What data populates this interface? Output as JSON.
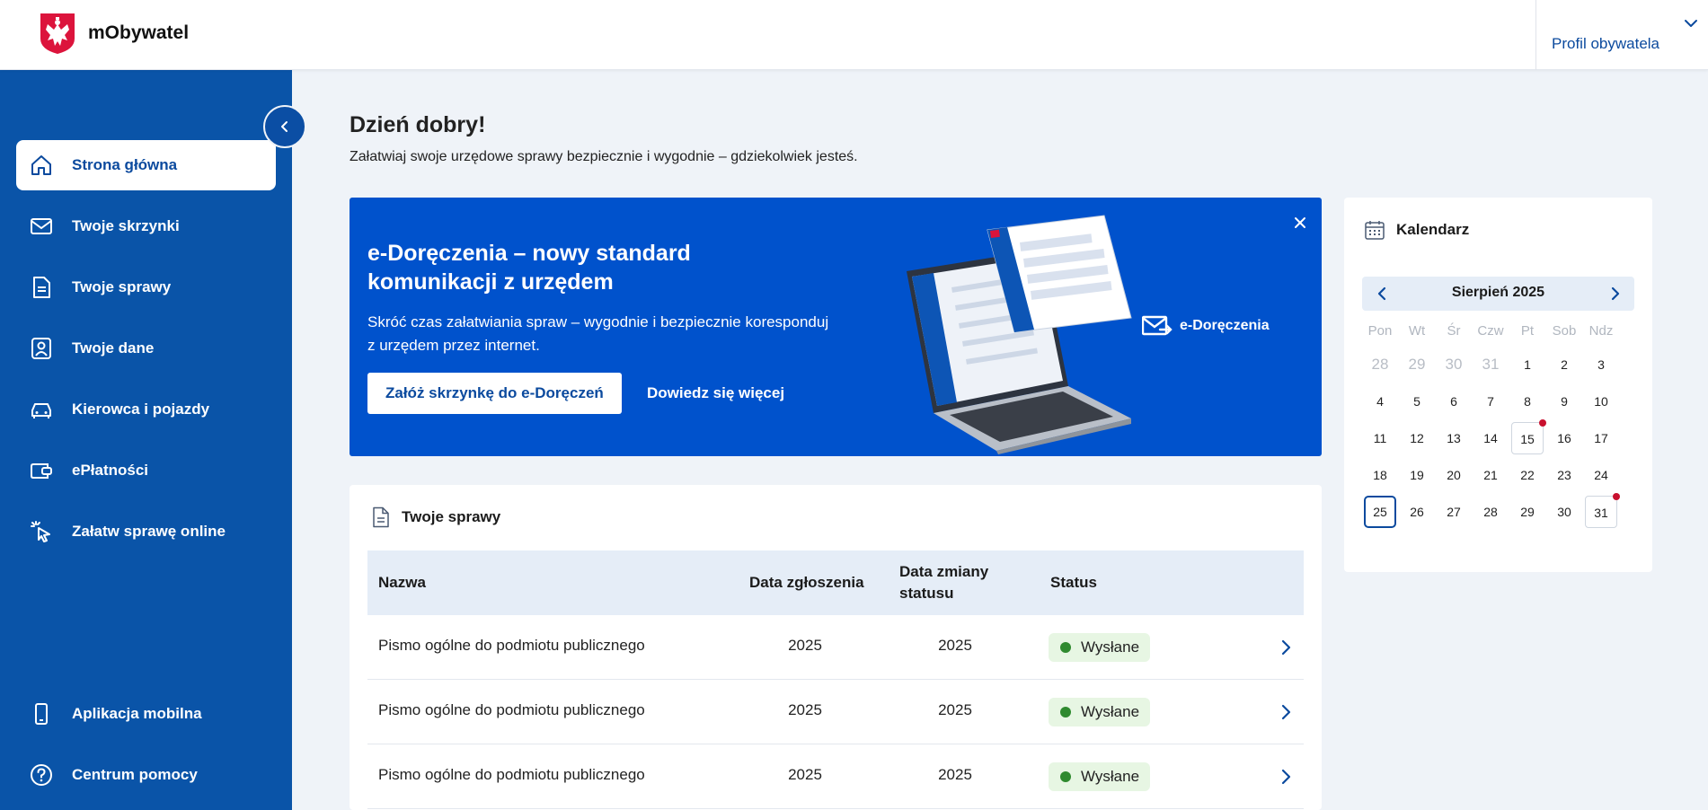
{
  "header": {
    "app_name": "mObywatel",
    "profile_label": "Profil obywatela"
  },
  "sidebar": {
    "items": [
      {
        "label": "Strona główna",
        "icon": "home-icon",
        "active": true
      },
      {
        "label": "Twoje skrzynki",
        "icon": "mail-icon"
      },
      {
        "label": "Twoje sprawy",
        "icon": "document-icon"
      },
      {
        "label": "Twoje dane",
        "icon": "id-card-icon"
      },
      {
        "label": "Kierowca i pojazdy",
        "icon": "car-icon"
      },
      {
        "label": "ePłatności",
        "icon": "wallet-icon"
      },
      {
        "label": "Załatw sprawę online",
        "icon": "cursor-click-icon"
      }
    ],
    "bottom_items": [
      {
        "label": "Aplikacja mobilna",
        "icon": "phone-icon"
      },
      {
        "label": "Centrum pomocy",
        "icon": "help-icon"
      }
    ]
  },
  "main": {
    "greeting": "Dzień dobry!",
    "subtitle": "Załatwiaj swoje urzędowe sprawy bezpiecznie i wygodnie – gdziekolwiek jesteś."
  },
  "banner": {
    "title": "e-Doręczenia – nowy standard komunikacji z urzędem",
    "text": "Skróć czas załatwiania spraw – wygodnie i bezpiecznie koresponduj z urzędem przez internet.",
    "primary_button": "Załóż skrzynkę do e-Doręczeń",
    "link": "Dowiedz się więcej",
    "logo_text": "e-Doręczenia",
    "bg_color": "#0052cc"
  },
  "cases": {
    "title": "Twoje sprawy",
    "columns": {
      "name": "Nazwa",
      "submitted": "Data zgłoszenia",
      "changed": "Data zmiany statusu",
      "status": "Status"
    },
    "rows": [
      {
        "name": "Pismo ogólne do podmiotu publicznego",
        "submitted": "2025",
        "changed": "2025",
        "status": "Wysłane"
      },
      {
        "name": "Pismo ogólne do podmiotu publicznego",
        "submitted": "2025",
        "changed": "2025",
        "status": "Wysłane"
      },
      {
        "name": "Pismo ogólne do podmiotu publicznego",
        "submitted": "2025",
        "changed": "2025",
        "status": "Wysłane"
      }
    ]
  },
  "calendar": {
    "title": "Kalendarz",
    "month": "Sierpień 2025",
    "weekdays": [
      "Pon",
      "Wt",
      "Śr",
      "Czw",
      "Pt",
      "Sob",
      "Ndz"
    ],
    "weeks": [
      [
        {
          "d": "28",
          "muted": true
        },
        {
          "d": "29",
          "muted": true
        },
        {
          "d": "30",
          "muted": true
        },
        {
          "d": "31",
          "muted": true
        },
        {
          "d": "1"
        },
        {
          "d": "2"
        },
        {
          "d": "3"
        }
      ],
      [
        {
          "d": "4"
        },
        {
          "d": "5"
        },
        {
          "d": "6"
        },
        {
          "d": "7"
        },
        {
          "d": "8"
        },
        {
          "d": "9"
        },
        {
          "d": "10"
        }
      ],
      [
        {
          "d": "11"
        },
        {
          "d": "12"
        },
        {
          "d": "13"
        },
        {
          "d": "14"
        },
        {
          "d": "15",
          "event": true
        },
        {
          "d": "16"
        },
        {
          "d": "17"
        }
      ],
      [
        {
          "d": "18"
        },
        {
          "d": "19"
        },
        {
          "d": "20"
        },
        {
          "d": "21"
        },
        {
          "d": "22"
        },
        {
          "d": "23"
        },
        {
          "d": "24"
        }
      ],
      [
        {
          "d": "25",
          "today": true
        },
        {
          "d": "26"
        },
        {
          "d": "27"
        },
        {
          "d": "28"
        },
        {
          "d": "29"
        },
        {
          "d": "30"
        },
        {
          "d": "31",
          "event": true
        }
      ]
    ],
    "event_color": "#c8102e"
  },
  "colors": {
    "sidebar": "#0a54a8",
    "accent": "#0b4a9e",
    "status_ok": "#2f8a2f"
  }
}
